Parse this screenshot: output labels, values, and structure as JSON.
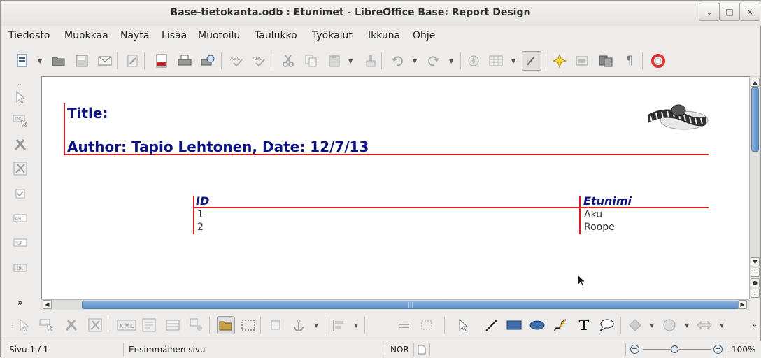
{
  "window": {
    "title": "Base-tietokanta.odb : Etunimet - LibreOffice Base: Report Design"
  },
  "window_controls": {
    "minimize": "⌄",
    "maximize": "□",
    "close": "×"
  },
  "menu": [
    "Tiedosto",
    "Muokkaa",
    "Näytä",
    "Lisää",
    "Muotoilu",
    "Taulukko",
    "Työkalut",
    "Ikkuna",
    "Ohje"
  ],
  "toolbar_icons": [
    "new-document-icon",
    "open-icon",
    "save-icon",
    "email-icon",
    "edit-mode-icon",
    "export-pdf-icon",
    "print-icon",
    "print-preview-icon",
    "spellcheck-icon",
    "autospellcheck-icon",
    "cut-icon",
    "copy-icon",
    "paste-icon",
    "clone-formatting-icon",
    "undo-icon",
    "redo-icon",
    "navigator-icon",
    "table-icon",
    "show-draw-functions-icon",
    "gallery-icon",
    "data-sources-icon",
    "formatting-marks-icon",
    "help-icon"
  ],
  "report": {
    "title_label": "Title:",
    "author_line": "Author: Tapio Lehtonen, Date: 12/7/13",
    "columns": [
      "ID",
      "Etunimi"
    ],
    "rows": [
      {
        "id": "1",
        "etunimi": "Aku"
      },
      {
        "id": "2",
        "etunimi": "Roope"
      }
    ]
  },
  "left_toolbar": {
    "labels": {
      "button": "OK",
      "text": "AB[",
      "formatted": "%F",
      "ok_small": "OK"
    },
    "more": "»"
  },
  "bottom_toolbar": {
    "xml_label": "XML"
  },
  "hscroll_grip": "|||",
  "statusbar": {
    "page": "Sivu 1 / 1",
    "page_style": "Ensimmäinen sivu",
    "mode": "NOR",
    "zoom": "100%",
    "zoom_minus": "−",
    "zoom_plus": "+"
  },
  "colors": {
    "report_text": "#0c137e",
    "guide_lines": "#dd1f1f"
  }
}
